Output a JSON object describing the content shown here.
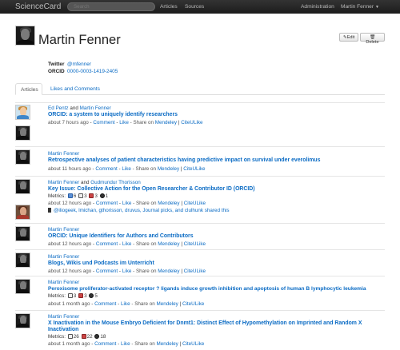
{
  "topbar": {
    "brand": "ScienceCard",
    "search_placeholder": "Search",
    "nav_articles": "Articles",
    "nav_sources": "Sources",
    "nav_admin": "Administration",
    "nav_user": "Martin Fenner"
  },
  "profile": {
    "name": "Martin Fenner",
    "edit_label": "Edit",
    "delete_label": "Delete",
    "twitter_label": "Twitter",
    "twitter_value": "@mfenner",
    "orcid_label": "ORCID",
    "orcid_value": "0000-0003-1419-2405"
  },
  "tabs": [
    {
      "label": "Articles",
      "active": true
    },
    {
      "label": "Likes and Comments",
      "active": false
    }
  ],
  "articles": [
    {
      "authors": [
        "Ed Pentz",
        "Martin Fenner"
      ],
      "title": "ORCID: a system to uniquely identify researchers",
      "time": "about 7 hours ago"
    },
    {
      "authors": [
        "Martin Fenner"
      ],
      "title": "Retrospective analyses of patient characteristics having predictive impact on survival under everolimus",
      "time": "about 11 hours ago"
    },
    {
      "authors": [
        "Martin Fenner",
        "Gudmundur Thorisson"
      ],
      "title": "Key Issue: Collective Action for the Open Researcher & Contributor ID (ORCID)",
      "metrics": [
        "6",
        "3",
        "3",
        "1"
      ],
      "time": "about 12 hours ago",
      "shared_by": "@iliogeek, lmichan, gthorisson, druvus, Journal picks, and clulhunk shared this"
    },
    {
      "authors": [
        "Martin Fenner"
      ],
      "title": "ORCID: Unique Identifiers for Authors and Contributors",
      "time": "about 12 hours ago"
    },
    {
      "authors": [
        "Martin Fenner"
      ],
      "title": "Blogs, Wikis und Podcasts im Unterricht",
      "time": "about 12 hours ago"
    },
    {
      "authors": [
        "Martin Fenner"
      ],
      "title": "Peroxisome proliferator-activated receptor ? ligands induce growth inhibition and apoptosis of human B lymphocytic leukemia",
      "metrics": [
        "3",
        "3",
        "5"
      ],
      "time": "about 1 month ago"
    },
    {
      "authors": [
        "Martin Fenner"
      ],
      "title": "X Inactivation in the Mouse Embryo Deficient for Dnmt1: Distinct Effect of Hypomethylation on Imprinted and Random X",
      "title2": "Inactivation",
      "metrics": [
        "26",
        "22",
        "18"
      ],
      "time": "about 1 month ago"
    }
  ],
  "common": {
    "and": "and",
    "dash": " - ",
    "comment": "Comment",
    "like": "Like",
    "share_on": "Share on",
    "mendeley": "Mendeley",
    "pipe": "|",
    "citeulike": "CiteULike",
    "metrics_label": "Metrics:"
  },
  "colors": {
    "link": "#0a6bc4",
    "topbar": "#222222"
  }
}
